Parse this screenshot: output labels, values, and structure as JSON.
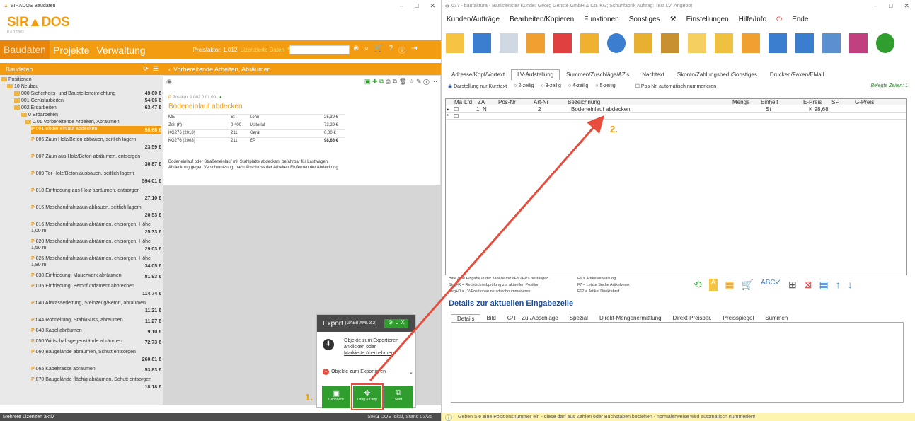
{
  "left_window": {
    "title": "SIRADOS Baudaten",
    "logo": "SIR▲DOS",
    "version": "8.4.0.1303",
    "nav": {
      "baudaten": "Baudaten",
      "projekte": "Projekte",
      "verwaltung": "Verwaltung"
    },
    "preisfaktor": "Preisfaktor: 1,012",
    "lizenz": "Lizenzierte Daten",
    "panel_left_title": "Baudaten",
    "panel_right_title": "Vorbereitende Arbeiten, Abräumen",
    "tree": [
      {
        "label": "Positionen",
        "indent": 0
      },
      {
        "label": "10 Neubau",
        "indent": 1
      },
      {
        "label": "000 Sicherheits- und Baustelleneinrichtung",
        "price": "49,60 €",
        "indent": 2
      },
      {
        "label": "001 Gerüstarbeiten",
        "price": "54,06 €",
        "indent": 2
      },
      {
        "label": "002 Erdarbeiten",
        "price": "63,47 €",
        "indent": 2
      },
      {
        "label": "0 Erdarbeiten",
        "indent": 3
      },
      {
        "label": "0.01 Vorbereitende Arbeiten, Abräumen",
        "indent": 4
      },
      {
        "label": "001 Bodeneinlauf abdecken",
        "price": "98,68 €",
        "indent": 5,
        "selected": true
      },
      {
        "label": "006 Zaun Holz/Beton abbauen, seitlich lagern",
        "price": "23,59 €",
        "indent": 5
      },
      {
        "label": "007 Zaun aus Holz/Beton abräumen, entsorgen",
        "price": "30,87 €",
        "indent": 5
      },
      {
        "label": "009 Tor Holz/Beton ausbauen, seitlich lagern",
        "price": "594,01 €",
        "indent": 5
      },
      {
        "label": "010 Einfriedung aus Holz abräumen, entsorgen",
        "price": "27,10 €",
        "indent": 5
      },
      {
        "label": "015 Maschendrahtzaun abbauen, seitlich lagern",
        "price": "20,53 €",
        "indent": 5
      },
      {
        "label": "016 Maschendrahtzaun abräumen, entsorgen, Höhe 1,00 m",
        "price": "25,33 €",
        "indent": 5
      },
      {
        "label": "020 Maschendrahtzaun abräumen, entsorgen, Höhe 1,50 m",
        "price": "29,03 €",
        "indent": 5
      },
      {
        "label": "025 Maschendrahtzaun abräumen, entsorgen, Höhe 1,80 m",
        "price": "34,05 €",
        "indent": 5
      },
      {
        "label": "030 Einfriedung, Mauerwerk abräumen",
        "price": "81,93 €",
        "indent": 5
      },
      {
        "label": "035 Einfriedung, Betonfundament abbrechen",
        "price": "114,74 €",
        "indent": 5
      },
      {
        "label": "040 Abwasserleitung, Steinzeug/Beton, abräumen",
        "price": "11,21 €",
        "indent": 5
      },
      {
        "label": "044 Rohrleitung, Stahl/Guss, abräumen",
        "price": "11,27 €",
        "indent": 5
      },
      {
        "label": "048 Kabel abräumen",
        "price": "9,10 €",
        "indent": 5
      },
      {
        "label": "050 Wirtschaftsgegenstände abräumen",
        "price": "72,73 €",
        "indent": 5
      },
      {
        "label": "060 Baugelände abräumen, Schutt entsorgen",
        "price": "260,61 €",
        "indent": 5
      },
      {
        "label": "065 Kabeltrasse abräumen",
        "price": "53,83 €",
        "indent": 5
      },
      {
        "label": "070 Baugelände flächig abräumen, Schutt entsorgen",
        "price": "18,18 €",
        "indent": 5
      }
    ],
    "detail": {
      "position": "Position: 1.002.0.01.001",
      "title": "Bodeneinlauf abdecken",
      "rows": [
        {
          "k": "ME",
          "v": "St",
          "k2": "Lohn",
          "v2": "25,39 €"
        },
        {
          "k": "Zeit (h)",
          "v": "0,400",
          "k2": "Material",
          "v2": "73,29 €"
        },
        {
          "k": "KG276 (2018)",
          "v": "211",
          "k2": "Gerät",
          "v2": "0,00 €"
        },
        {
          "k": "KG276 (2008)",
          "v": "211",
          "k2": "EP",
          "v2": "98,68 €"
        }
      ],
      "text": "Bodeneinlauf oder Straßeneinlauf mit Stahlplatte abdecken, befahrbar für Lastwagen. Abdeckung gegen Verschmutzung, nach Abschluss der Arbeiten Entfernen der Abdeckung."
    },
    "export": {
      "title": "Export",
      "format": "(GAEB XML 3.2)",
      "info1": "Objekte zum Exportieren",
      "info2": "anklicken oder",
      "info3": "Markierte übernehmen",
      "badge": "1",
      "objects": "Objekte zum Exportieren",
      "btn_clipboard": "Clipboard",
      "btn_drag": "Drag & Drop",
      "btn_start": "Start"
    },
    "status_left": "Mehrere Lizenzen aktiv",
    "status_right": "SIR▲DOS lokal, Stand 03/25",
    "marker1": "1."
  },
  "right_window": {
    "title": "037 - baufaktura - Basisfenster     Kunde: Georg Genste GmbH & Co. KG; Schuhfabrik     Auftrag: Test     LV: Angebot",
    "menu": [
      "Kunden/Aufträge",
      "Bearbeiten/Kopieren",
      "Funktionen",
      "Sonstiges",
      "Einstellungen",
      "Hilfe/Info",
      "Ende"
    ],
    "tabs": [
      "Adresse/Kopf/Vortext",
      "LV-Aufstellung",
      "Summen/Zuschläge/AZ's",
      "Nachtext",
      "Skonto/Zahlungsbed./Sonstiges",
      "Drucken/Faxen/EMail"
    ],
    "options": [
      "Darstellung nur Kurztext",
      "2-zeilig",
      "3-zeilig",
      "4-zeilig",
      "5-zeilig",
      "Pos-Nr. automatisch nummerieren"
    ],
    "belegte": "Belegte Zeilen: 1",
    "grid_headers": [
      "Ma",
      "Lfd",
      "ZA",
      "Pos-Nr",
      "Art-Nr",
      "Bezeichnung",
      "Menge",
      "Einheit",
      "E-Preis",
      "SF",
      "G-Preis"
    ],
    "grid_row": {
      "lfd": "1",
      "za": "N",
      "art": "2",
      "bez": "Bodeneinlauf abdecken",
      "einheit": "St",
      "epreis": "K 98,68"
    },
    "hints": [
      "Bitte jede Eingabe in der Tabelle mit <ENTER> bestätigen.",
      "Strg+R = Rechtschreibprüfung zur aktuellen Position",
      "Strg+D = LV-Positionen neu durchnummerieren",
      "F6 = Artikelverwaltung",
      "F7 = Letzte Suche Artikelverw.",
      "F12 = Artikel Direktabruf"
    ],
    "details_title": "Details zur aktuellen Eingabezeile",
    "details_tabs": [
      "Details",
      "Bild",
      "G/T - Zu-/Abschläge",
      "Spezial",
      "Direkt-Mengenermittlung",
      "Direkt-Preisber.",
      "Preisspiegel",
      "Summen"
    ],
    "status": "Geben Sie eine Positionsnummer ein - diese darf aus Zahlen oder Buchstaben bestehen - normalerweise wird automatisch nummeriert!",
    "marker2": "2."
  },
  "colors": {
    "orange": "#f39c12",
    "green": "#2f9e2f",
    "red": "#e74c3c",
    "blue": "#1a4e9e"
  }
}
